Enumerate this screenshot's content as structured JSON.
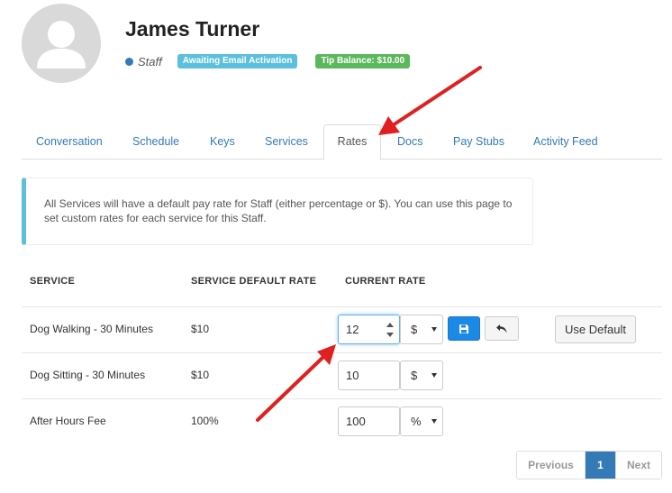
{
  "profile": {
    "name": "James Turner",
    "role": "Staff",
    "status_badge": "Awaiting Email Activation",
    "tip_badge": "Tip Balance: $10.00"
  },
  "tabs": [
    {
      "label": "Conversation",
      "active": false
    },
    {
      "label": "Schedule",
      "active": false
    },
    {
      "label": "Keys",
      "active": false
    },
    {
      "label": "Services",
      "active": false
    },
    {
      "label": "Rates",
      "active": true
    },
    {
      "label": "Docs",
      "active": false
    },
    {
      "label": "Pay Stubs",
      "active": false
    },
    {
      "label": "Activity Feed",
      "active": false
    }
  ],
  "alert": {
    "text": "All Services will have a default pay rate for Staff (either percentage or $). You can use this page to set custom rates for each service for this Staff."
  },
  "table": {
    "headers": [
      "SERVICE",
      "SERVICE DEFAULT RATE",
      "CURRENT RATE"
    ],
    "rows": [
      {
        "service": "Dog Walking - 30 Minutes",
        "default_rate": "$10",
        "current_rate": "12",
        "unit": "$",
        "editing": true
      },
      {
        "service": "Dog Sitting - 30 Minutes",
        "default_rate": "$10",
        "current_rate": "10",
        "unit": "$",
        "editing": false
      },
      {
        "service": "After Hours Fee",
        "default_rate": "100%",
        "current_rate": "100",
        "unit": "%",
        "editing": false
      }
    ],
    "use_default_label": "Use Default"
  },
  "pagination": {
    "previous": "Previous",
    "current": "1",
    "next": "Next"
  },
  "colors": {
    "link": "#337ab7",
    "info": "#5bc0de",
    "success": "#5cb85c",
    "primary_button": "#1a8ae6",
    "annotation_arrow": "#e02020"
  },
  "icons": {
    "avatar": "user-silhouette-icon",
    "save": "floppy-disk-icon",
    "undo": "undo-arrow-icon"
  }
}
